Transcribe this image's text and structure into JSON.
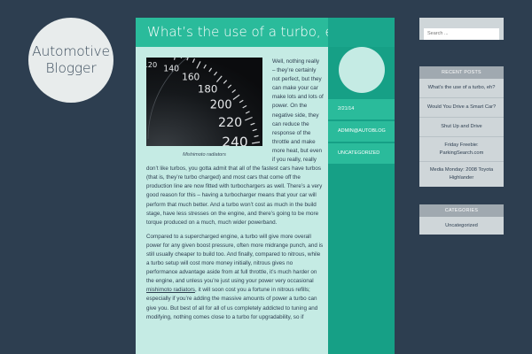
{
  "site": {
    "title": "Automotive Blogger"
  },
  "post": {
    "title": "What’s the use of a turbo, eh?",
    "meta": [
      "2/21/14",
      "ADMIN@AUTOBLOG",
      "UNCATEGORIZED"
    ],
    "image_caption": "Mishimoto radiators",
    "speedometer_labels": [
      "100",
      "120",
      "140",
      "160",
      "180",
      "200",
      "220",
      "240"
    ],
    "intro": "Well, nothing really – they’re certainly not perfect, but they can make your car make lots and lots of power. On the negative side, they can reduce the response of the throttle and make more heat, but even if you really, really don’t like turbos, you gotta admit that all of the fastest cars have turbos (that is, they’re turbo charged) and most cars that come off the production line are now fitted with turbochargers as well. There’s a very good reason for this – having a turbocharger means that your car will perform that much better. And a turbo won’t cost as much in the build stage, have less stresses on the engine, and there’s going to be more torque produced on a much, much wider powerband.",
    "p2_before": "Compared to a supercharged engine, a turbo will give more overall power for any given boost pressure, often more midrange punch, and is still usually cheaper to build too. And finally, compared to nitrous, while a turbo setup will cost more money initially, nitrous gives no performance advantage aside from at full throttle, it’s much harder on the engine, and unless you’re just using your power very occasional ",
    "p2_link": "mishimoto radiators",
    "p2_after": ", it will soon cost you a fortune in nitrous refills; especially if you’re adding the massive amounts of power a turbo can give you. But best of all for all of us completely addicted to tuning and modifying, nothing comes close to a turbo for upgradability, so if"
  },
  "sidebar": {
    "search_placeholder": "Search ...",
    "recent_title": "RECENT POSTS",
    "recent_posts": [
      "What’s the use of a turbo, eh?",
      "Would You Drive a Smart Car?",
      "Shut Up and Drive",
      "Friday Freebie: ParkingSearch.com",
      "Media Monday: 2008 Toyota Highlander"
    ],
    "categories_title": "CATEGORIES",
    "categories": [
      "Uncategorized"
    ]
  },
  "colors": {
    "background": "#2d3e50",
    "accent": "#2abb9b",
    "accent_dark": "#16a086",
    "content_bg": "#c5ebe4",
    "sidebar_bg": "#cfd6d9"
  }
}
